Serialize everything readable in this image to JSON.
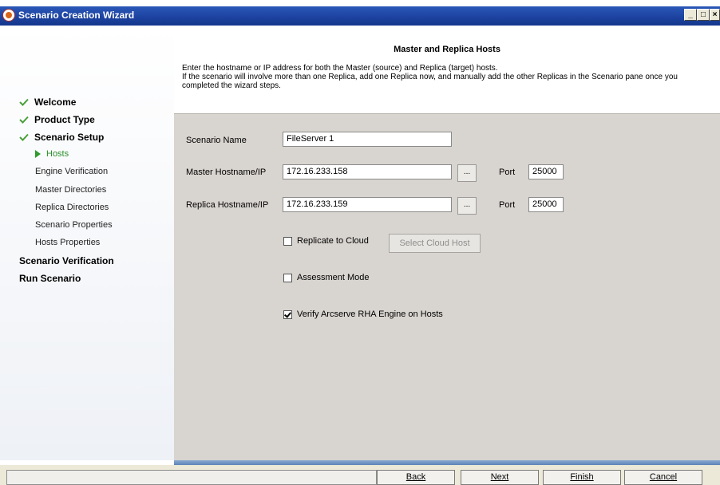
{
  "window": {
    "title": "Scenario Creation Wizard",
    "controls": [
      "_",
      "□",
      "×"
    ]
  },
  "sidebar": {
    "items": [
      {
        "label": "Welcome",
        "state": "done"
      },
      {
        "label": "Product Type",
        "state": "done"
      },
      {
        "label": "Scenario Setup",
        "state": "done"
      },
      {
        "label": "Hosts",
        "state": "current"
      },
      {
        "label": "Engine Verification",
        "state": "pending"
      },
      {
        "label": "Master Directories",
        "state": "pending"
      },
      {
        "label": "Replica Directories",
        "state": "pending"
      },
      {
        "label": "Scenario Properties",
        "state": "pending"
      },
      {
        "label": "Hosts Properties",
        "state": "pending"
      },
      {
        "label": "Scenario Verification",
        "state": "major"
      },
      {
        "label": "Run Scenario",
        "state": "major"
      }
    ]
  },
  "header": {
    "title": "Master and Replica Hosts",
    "line1": "Enter the hostname or IP address for both the Master (source) and Replica (target) hosts.",
    "line2": "If the scenario will involve more than one Replica, add one Replica now, and manually add the other Replicas in the Scenario pane once you completed the wizard steps."
  },
  "form": {
    "scenario_name_label": "Scenario Name",
    "scenario_name_value": "FileServer 1",
    "master_label": "Master Hostname/IP",
    "master_value": "172.16.233.158",
    "master_port_label": "Port",
    "master_port_value": "25000",
    "replica_label": "Replica Hostname/IP",
    "replica_value": "172.16.233.159",
    "replica_port_label": "Port",
    "replica_port_value": "25000",
    "browse_label": "...",
    "replicate_cloud_label": "Replicate to Cloud",
    "replicate_cloud_checked": false,
    "select_cloud_host_label": "Select Cloud Host",
    "assessment_label": "Assessment Mode",
    "assessment_checked": false,
    "verify_label": "Verify  Arcserve  RHA Engine on Hosts",
    "verify_checked": true
  },
  "footer": {
    "back_label": "Back",
    "next_label": "Next",
    "finish_label": "Finish",
    "cancel_label": "Cancel"
  },
  "colors": {
    "titlebar": "#1d43a0",
    "panel": "#d8d4cf",
    "check_green": "#4aa03a"
  }
}
